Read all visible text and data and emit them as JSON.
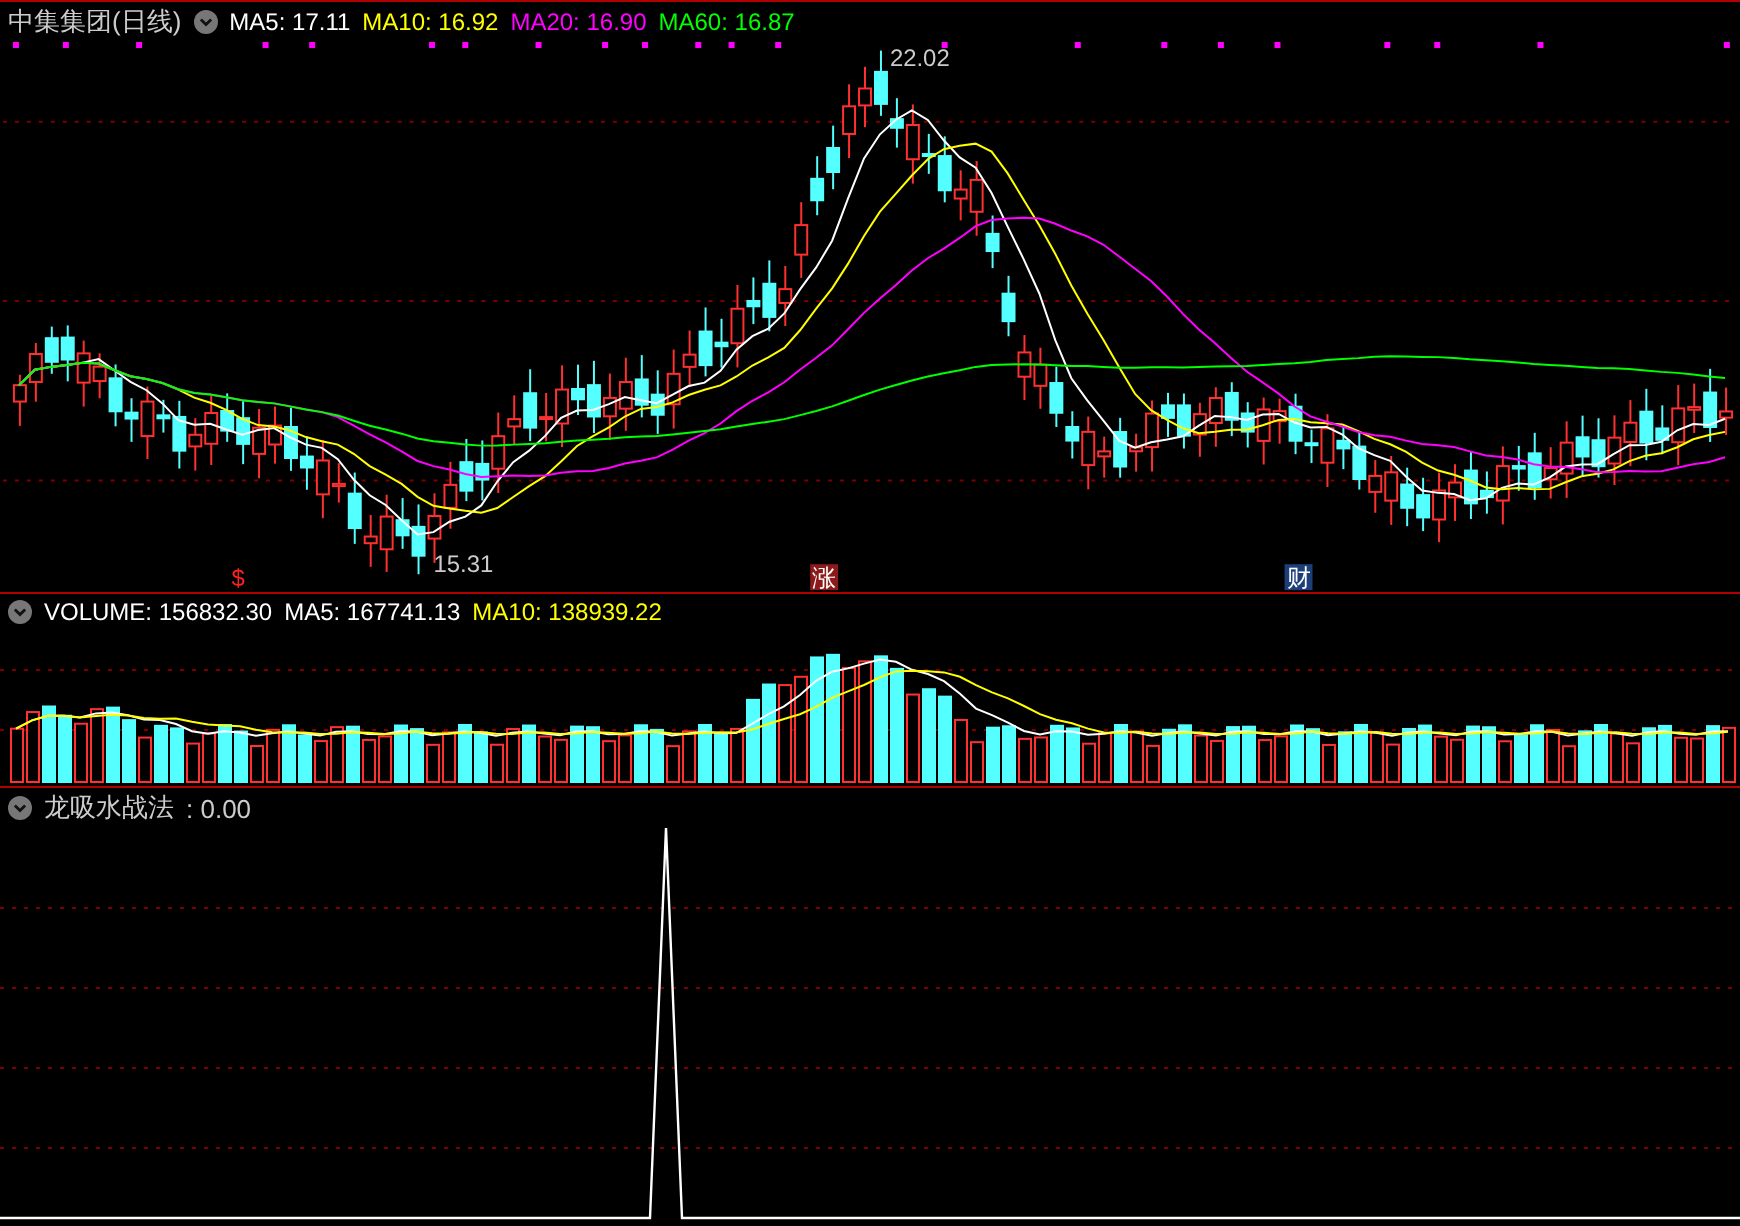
{
  "price_panel": {
    "title": "中集集团(日线)",
    "indicators": [
      {
        "label": "MA5: 17.11",
        "color": "#ffffff"
      },
      {
        "label": "MA10: 16.92",
        "color": "#ffff00"
      },
      {
        "label": "MA20: 16.90",
        "color": "#ff00ff"
      },
      {
        "label": "MA60: 16.87",
        "color": "#00ff00"
      }
    ],
    "high_label": "22.02",
    "low_label": "15.31",
    "markers": [
      {
        "text": "$",
        "kind": "plain",
        "color": "#ff2020"
      },
      {
        "text": "涨",
        "kind": "boxed",
        "color": "#8b1a1a"
      },
      {
        "text": "财",
        "kind": "boxed",
        "color": "#1c3f7a"
      }
    ]
  },
  "volume_panel": {
    "indicators": [
      {
        "label": "VOLUME: 156832.30",
        "color": "#ffffff"
      },
      {
        "label": "MA5: 167741.13",
        "color": "#ffffff"
      },
      {
        "label": "MA10: 138939.22",
        "color": "#ffff00"
      }
    ]
  },
  "indicator_panel": {
    "title": "龙吸水战法",
    "value": ": 0.00"
  }
}
